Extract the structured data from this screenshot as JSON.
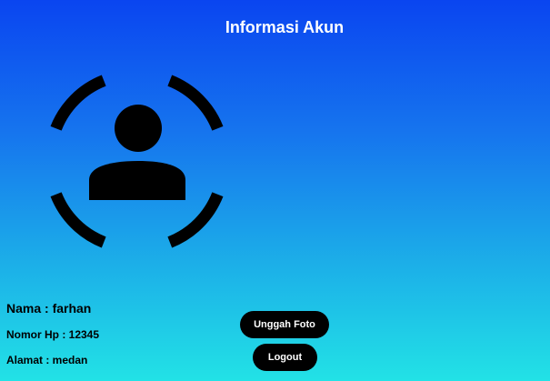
{
  "header": {
    "title": "Informasi Akun"
  },
  "profile": {
    "avatar_icon": "account-box-outline-icon",
    "name_line": "Nama : farhan",
    "phone_line": "Nomor Hp : 12345",
    "address_line": "Alamat : medan"
  },
  "actions": {
    "upload_label": "Unggah Foto",
    "logout_label": "Logout"
  },
  "colors": {
    "gradient_top": "#0a45f0",
    "gradient_bottom": "#22e2e6",
    "button_bg": "#000000",
    "button_text": "#ffffff"
  }
}
